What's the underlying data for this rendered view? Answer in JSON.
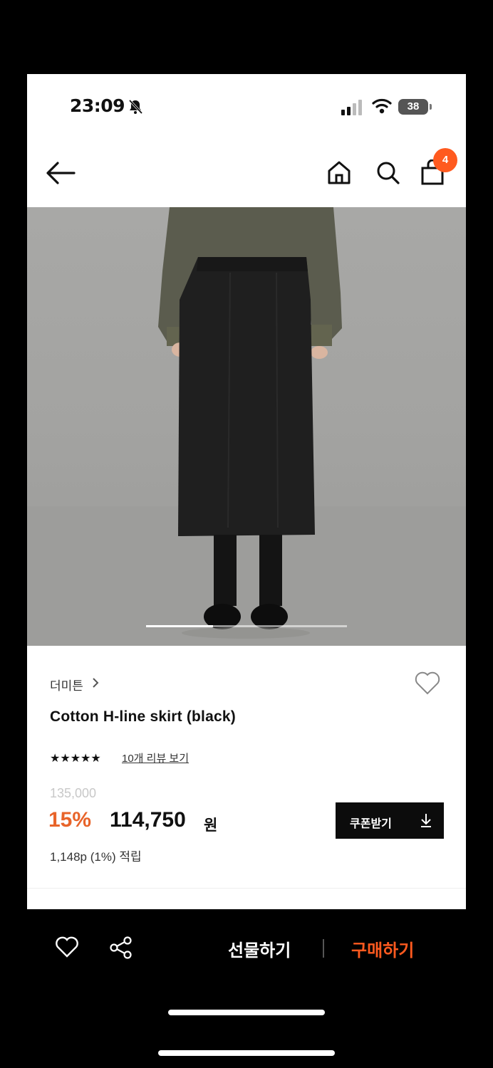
{
  "status_bar": {
    "time": "23:09",
    "battery": "38",
    "bell_icon": "bell-slash-icon"
  },
  "header": {
    "back_icon": "arrow-left-icon",
    "home_icon": "home-icon",
    "search_icon": "search-icon",
    "bag_icon": "shopping-bag-icon",
    "cart_count": "4",
    "accent": "#ff5a1f"
  },
  "product": {
    "brand": "더미튼",
    "title": "Cotton H-line skirt (black)",
    "rating_stars": "★★★★★",
    "reviews_link": "10개 리뷰 보기",
    "original_price": "135,000",
    "discount": "15%",
    "sale_price": "114,750",
    "currency": "원",
    "points": "1,148p (1%) 적립",
    "coupon_label": "쿠폰받기",
    "coupon_icon": "download-icon",
    "wish_icon": "heart-outline-icon",
    "carousel": {
      "current": 1,
      "total": 3
    }
  },
  "bottom_bar": {
    "wish_icon": "heart-outline-icon",
    "share_icon": "share-icon",
    "gift_label": "선물하기",
    "buy_label": "구매하기",
    "buy_color": "#ff5a1f"
  }
}
